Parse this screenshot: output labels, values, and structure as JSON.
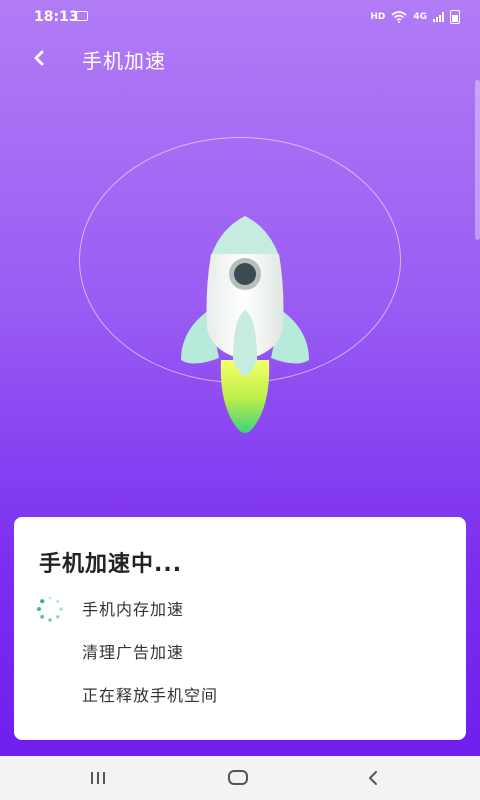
{
  "status_bar": {
    "time": "18:13",
    "hd": "HD",
    "network": "4G",
    "icons": [
      "image-icon",
      "wifi-icon",
      "signal-icon",
      "battery-icon"
    ]
  },
  "header": {
    "title": "手机加速",
    "back_icon": "back-arrow-icon"
  },
  "illustration": {
    "icon": "rocket-icon"
  },
  "card": {
    "title": "手机加速中...",
    "tasks": [
      {
        "label": "手机内存加速",
        "state": "loading"
      },
      {
        "label": "清理广告加速",
        "state": "pending"
      },
      {
        "label": "正在释放手机空间",
        "state": "pending"
      }
    ]
  },
  "nav_bar": {
    "icons": [
      "recents-icon",
      "home-icon",
      "back-icon"
    ]
  },
  "colors": {
    "gradient_top": "#b27cf6",
    "gradient_bottom": "#6f1fee",
    "spinner": "#2bb673",
    "card_bg": "#ffffff"
  }
}
